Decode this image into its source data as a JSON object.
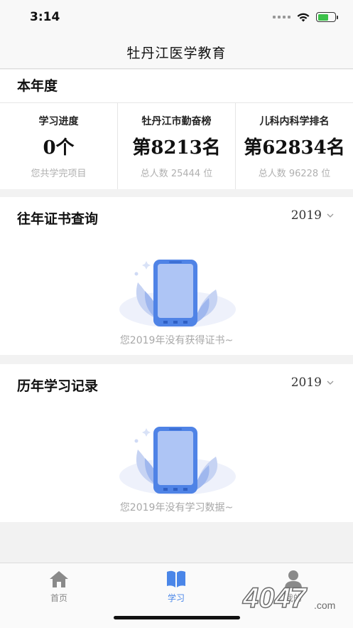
{
  "status_bar": {
    "time": "3:14"
  },
  "nav": {
    "title": "牡丹江医学教育"
  },
  "year_summary": {
    "title": "本年度",
    "stats": [
      {
        "label": "学习进度",
        "value": "0个",
        "sub": "您共学完项目"
      },
      {
        "label": "牡丹江市勤奋榜",
        "value": "第8213名",
        "sub": "总人数  25444  位"
      },
      {
        "label": "儿科内科学排名",
        "value": "第62834名",
        "sub": "总人数  96228  位"
      }
    ]
  },
  "certificates": {
    "title": "往年证书查询",
    "year": "2019",
    "empty_text": "您2019年没有获得证书~"
  },
  "records": {
    "title": "历年学习记录",
    "year": "2019",
    "empty_text": "您2019年没有学习数据~"
  },
  "tabbar": {
    "home": "首页",
    "study": "学习",
    "mine": "我的",
    "active": "study",
    "active_color": "#4a86e8"
  },
  "icons": [
    "wifi-icon",
    "battery-icon",
    "chevron-down-icon",
    "home-icon",
    "book-icon",
    "person-icon",
    "phone-illustration"
  ],
  "watermark": {
    "text": "4047.com"
  }
}
